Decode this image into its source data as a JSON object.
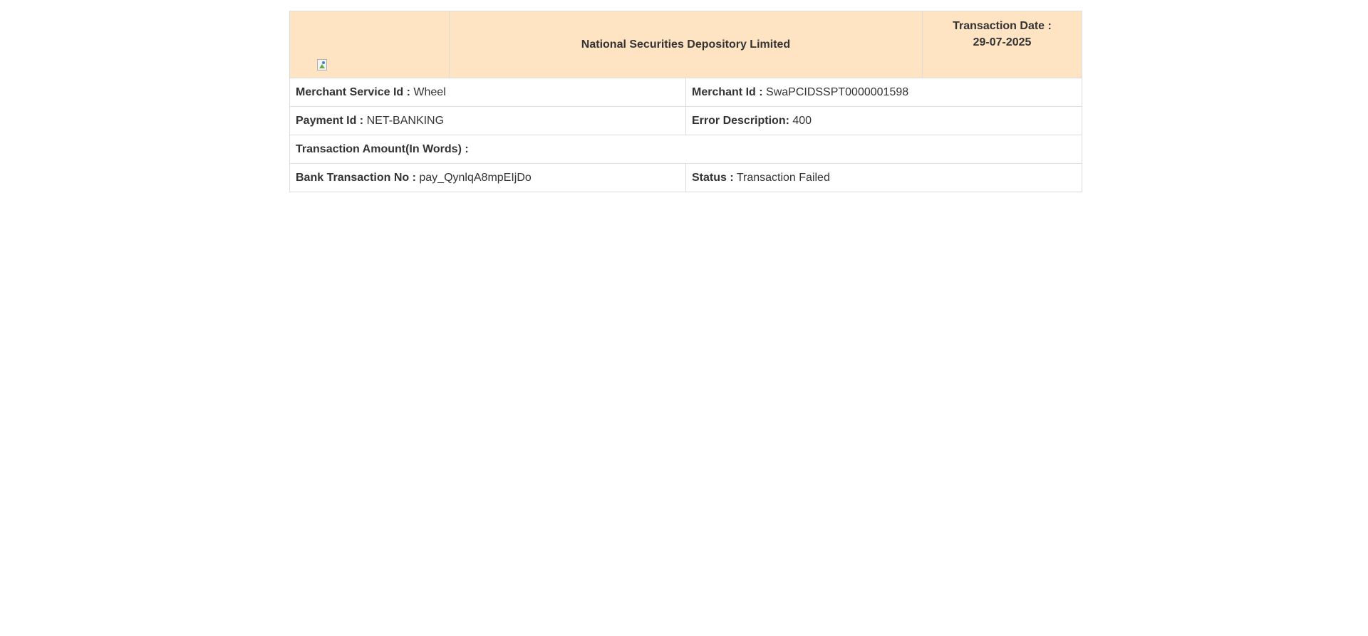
{
  "header": {
    "title": "National Securities Depository Limited",
    "date_label": "Transaction Date :",
    "date_value": "29-07-2025",
    "logo_icon": "broken-image-icon"
  },
  "rows": {
    "merchant_service_id": {
      "label": "Merchant Service Id :",
      "value": "Wheel"
    },
    "merchant_id": {
      "label": "Merchant Id :",
      "value": "SwaPCIDSSPT0000001598"
    },
    "payment_id": {
      "label": "Payment Id :",
      "value": "NET-BANKING"
    },
    "error_description": {
      "label": "Error Description:",
      "value": "400"
    },
    "amount_words": {
      "label": "Transaction Amount(In Words) :",
      "value": ""
    },
    "bank_txn_no": {
      "label": "Bank Transaction No :",
      "value": "pay_QynlqA8mpEIjDo"
    },
    "status": {
      "label": "Status :",
      "value": "Transaction Failed"
    }
  },
  "colors": {
    "header_bg": "#ffe4c4",
    "border": "#dddddd",
    "text": "#333333"
  }
}
